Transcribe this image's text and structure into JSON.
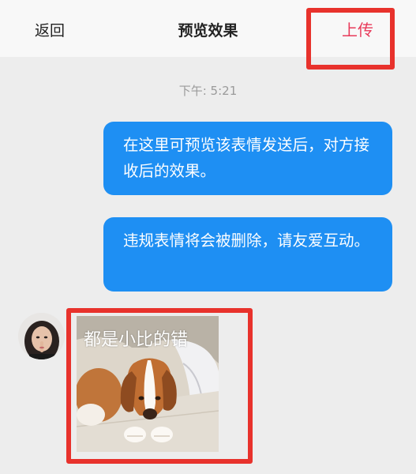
{
  "header": {
    "back_label": "返回",
    "title": "预览效果",
    "upload_label": "上传"
  },
  "chat": {
    "timestamp": "下午: 5:21",
    "messages": [
      {
        "text": "在这里可预览该表情发送后，对方接收后的效果。"
      },
      {
        "text": "违规表情将会被删除，请友爱互动。"
      }
    ],
    "sticker": {
      "caption": "都是小比的错"
    }
  },
  "colors": {
    "header_bg": "#f8f8f8",
    "page_bg": "#ededed",
    "bubble_bg": "#1e8ff3",
    "upload_text": "#e83a5a",
    "highlight_frame": "#e8322c"
  },
  "icons": {
    "avatar": "avatar-icon",
    "sticker": "beagle-puppy-sticker"
  }
}
